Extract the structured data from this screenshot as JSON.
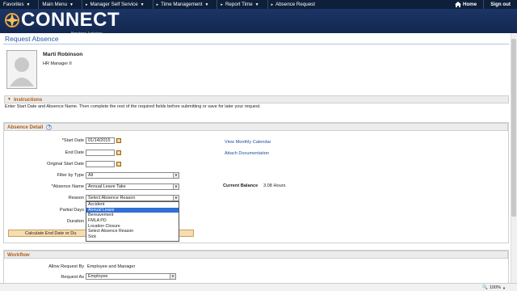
{
  "topnav": {
    "favorites": "Favorites",
    "main_menu": "Main Menu",
    "manager_self_service": "Manager Self Service",
    "time_management": "Time Management",
    "report_time": "Report Time",
    "absence_request": "Absence Request",
    "home": "Home",
    "sign_out": "Sign out"
  },
  "banner": {
    "logo": "CONNECT",
    "subtitle": "Maryland Judiciary"
  },
  "page": {
    "title": "Request Absence"
  },
  "employee": {
    "name": "Marti Robinson",
    "title": "HR Manager II"
  },
  "instructions": {
    "header": "Instructions",
    "text": "Enter Start Date and Absence Name. Then complete the rest of the required fields before submitting or save for later your request."
  },
  "absence_detail": {
    "header": "Absence Detail",
    "start_date_label": "*Start Date",
    "start_date_value": "01/14/2015",
    "end_date_label": "End Date",
    "end_date_value": "",
    "original_start_label": "Original Start Date",
    "original_start_value": "",
    "filter_label": "Filter by Type",
    "filter_value": "All",
    "absence_name_label": "*Absence Name",
    "absence_name_value": "Annual Leave Take",
    "reason_label": "Reason",
    "reason_value": "Select Absence Reason",
    "partial_days_label": "Partial Days",
    "duration_label": "Duration",
    "view_calendar_link": "View Monthly Calendar",
    "attach_doc_link": "Attach Documentation",
    "current_balance_label": "Current Balance",
    "current_balance_value": "3.08 Hours",
    "calc_button": "Calculate End Date or Du"
  },
  "reason_options": [
    "Accident",
    "Annual Leave",
    "Bereavement",
    "FMLA PD",
    "Location Closure",
    "Select Absence Reason",
    "Sick"
  ],
  "reason_selected_index": 1,
  "workflow": {
    "header": "Workflow",
    "allow_request_label": "Allow Request By",
    "allow_request_value": "Employee and Manager",
    "request_as_label": "Request As",
    "request_as_value": "Employee"
  },
  "status": {
    "zoom": "100%"
  },
  "colors": {
    "nav_bg": "#0e1f3a",
    "banner": "#1c3566",
    "section_title": "#b05b12",
    "link": "#1e4fa0",
    "highlight": "#2f6fd6"
  }
}
